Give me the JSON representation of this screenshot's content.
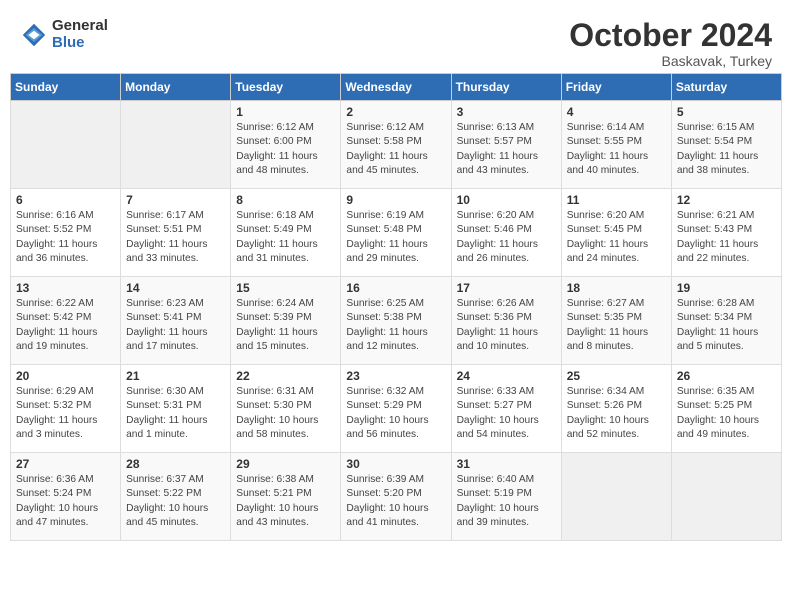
{
  "header": {
    "logo_general": "General",
    "logo_blue": "Blue",
    "month": "October 2024",
    "location": "Baskavak, Turkey"
  },
  "weekdays": [
    "Sunday",
    "Monday",
    "Tuesday",
    "Wednesday",
    "Thursday",
    "Friday",
    "Saturday"
  ],
  "weeks": [
    [
      {
        "day": "",
        "info": ""
      },
      {
        "day": "",
        "info": ""
      },
      {
        "day": "1",
        "info": "Sunrise: 6:12 AM\nSunset: 6:00 PM\nDaylight: 11 hours and 48 minutes."
      },
      {
        "day": "2",
        "info": "Sunrise: 6:12 AM\nSunset: 5:58 PM\nDaylight: 11 hours and 45 minutes."
      },
      {
        "day": "3",
        "info": "Sunrise: 6:13 AM\nSunset: 5:57 PM\nDaylight: 11 hours and 43 minutes."
      },
      {
        "day": "4",
        "info": "Sunrise: 6:14 AM\nSunset: 5:55 PM\nDaylight: 11 hours and 40 minutes."
      },
      {
        "day": "5",
        "info": "Sunrise: 6:15 AM\nSunset: 5:54 PM\nDaylight: 11 hours and 38 minutes."
      }
    ],
    [
      {
        "day": "6",
        "info": "Sunrise: 6:16 AM\nSunset: 5:52 PM\nDaylight: 11 hours and 36 minutes."
      },
      {
        "day": "7",
        "info": "Sunrise: 6:17 AM\nSunset: 5:51 PM\nDaylight: 11 hours and 33 minutes."
      },
      {
        "day": "8",
        "info": "Sunrise: 6:18 AM\nSunset: 5:49 PM\nDaylight: 11 hours and 31 minutes."
      },
      {
        "day": "9",
        "info": "Sunrise: 6:19 AM\nSunset: 5:48 PM\nDaylight: 11 hours and 29 minutes."
      },
      {
        "day": "10",
        "info": "Sunrise: 6:20 AM\nSunset: 5:46 PM\nDaylight: 11 hours and 26 minutes."
      },
      {
        "day": "11",
        "info": "Sunrise: 6:20 AM\nSunset: 5:45 PM\nDaylight: 11 hours and 24 minutes."
      },
      {
        "day": "12",
        "info": "Sunrise: 6:21 AM\nSunset: 5:43 PM\nDaylight: 11 hours and 22 minutes."
      }
    ],
    [
      {
        "day": "13",
        "info": "Sunrise: 6:22 AM\nSunset: 5:42 PM\nDaylight: 11 hours and 19 minutes."
      },
      {
        "day": "14",
        "info": "Sunrise: 6:23 AM\nSunset: 5:41 PM\nDaylight: 11 hours and 17 minutes."
      },
      {
        "day": "15",
        "info": "Sunrise: 6:24 AM\nSunset: 5:39 PM\nDaylight: 11 hours and 15 minutes."
      },
      {
        "day": "16",
        "info": "Sunrise: 6:25 AM\nSunset: 5:38 PM\nDaylight: 11 hours and 12 minutes."
      },
      {
        "day": "17",
        "info": "Sunrise: 6:26 AM\nSunset: 5:36 PM\nDaylight: 11 hours and 10 minutes."
      },
      {
        "day": "18",
        "info": "Sunrise: 6:27 AM\nSunset: 5:35 PM\nDaylight: 11 hours and 8 minutes."
      },
      {
        "day": "19",
        "info": "Sunrise: 6:28 AM\nSunset: 5:34 PM\nDaylight: 11 hours and 5 minutes."
      }
    ],
    [
      {
        "day": "20",
        "info": "Sunrise: 6:29 AM\nSunset: 5:32 PM\nDaylight: 11 hours and 3 minutes."
      },
      {
        "day": "21",
        "info": "Sunrise: 6:30 AM\nSunset: 5:31 PM\nDaylight: 11 hours and 1 minute."
      },
      {
        "day": "22",
        "info": "Sunrise: 6:31 AM\nSunset: 5:30 PM\nDaylight: 10 hours and 58 minutes."
      },
      {
        "day": "23",
        "info": "Sunrise: 6:32 AM\nSunset: 5:29 PM\nDaylight: 10 hours and 56 minutes."
      },
      {
        "day": "24",
        "info": "Sunrise: 6:33 AM\nSunset: 5:27 PM\nDaylight: 10 hours and 54 minutes."
      },
      {
        "day": "25",
        "info": "Sunrise: 6:34 AM\nSunset: 5:26 PM\nDaylight: 10 hours and 52 minutes."
      },
      {
        "day": "26",
        "info": "Sunrise: 6:35 AM\nSunset: 5:25 PM\nDaylight: 10 hours and 49 minutes."
      }
    ],
    [
      {
        "day": "27",
        "info": "Sunrise: 6:36 AM\nSunset: 5:24 PM\nDaylight: 10 hours and 47 minutes."
      },
      {
        "day": "28",
        "info": "Sunrise: 6:37 AM\nSunset: 5:22 PM\nDaylight: 10 hours and 45 minutes."
      },
      {
        "day": "29",
        "info": "Sunrise: 6:38 AM\nSunset: 5:21 PM\nDaylight: 10 hours and 43 minutes."
      },
      {
        "day": "30",
        "info": "Sunrise: 6:39 AM\nSunset: 5:20 PM\nDaylight: 10 hours and 41 minutes."
      },
      {
        "day": "31",
        "info": "Sunrise: 6:40 AM\nSunset: 5:19 PM\nDaylight: 10 hours and 39 minutes."
      },
      {
        "day": "",
        "info": ""
      },
      {
        "day": "",
        "info": ""
      }
    ]
  ]
}
